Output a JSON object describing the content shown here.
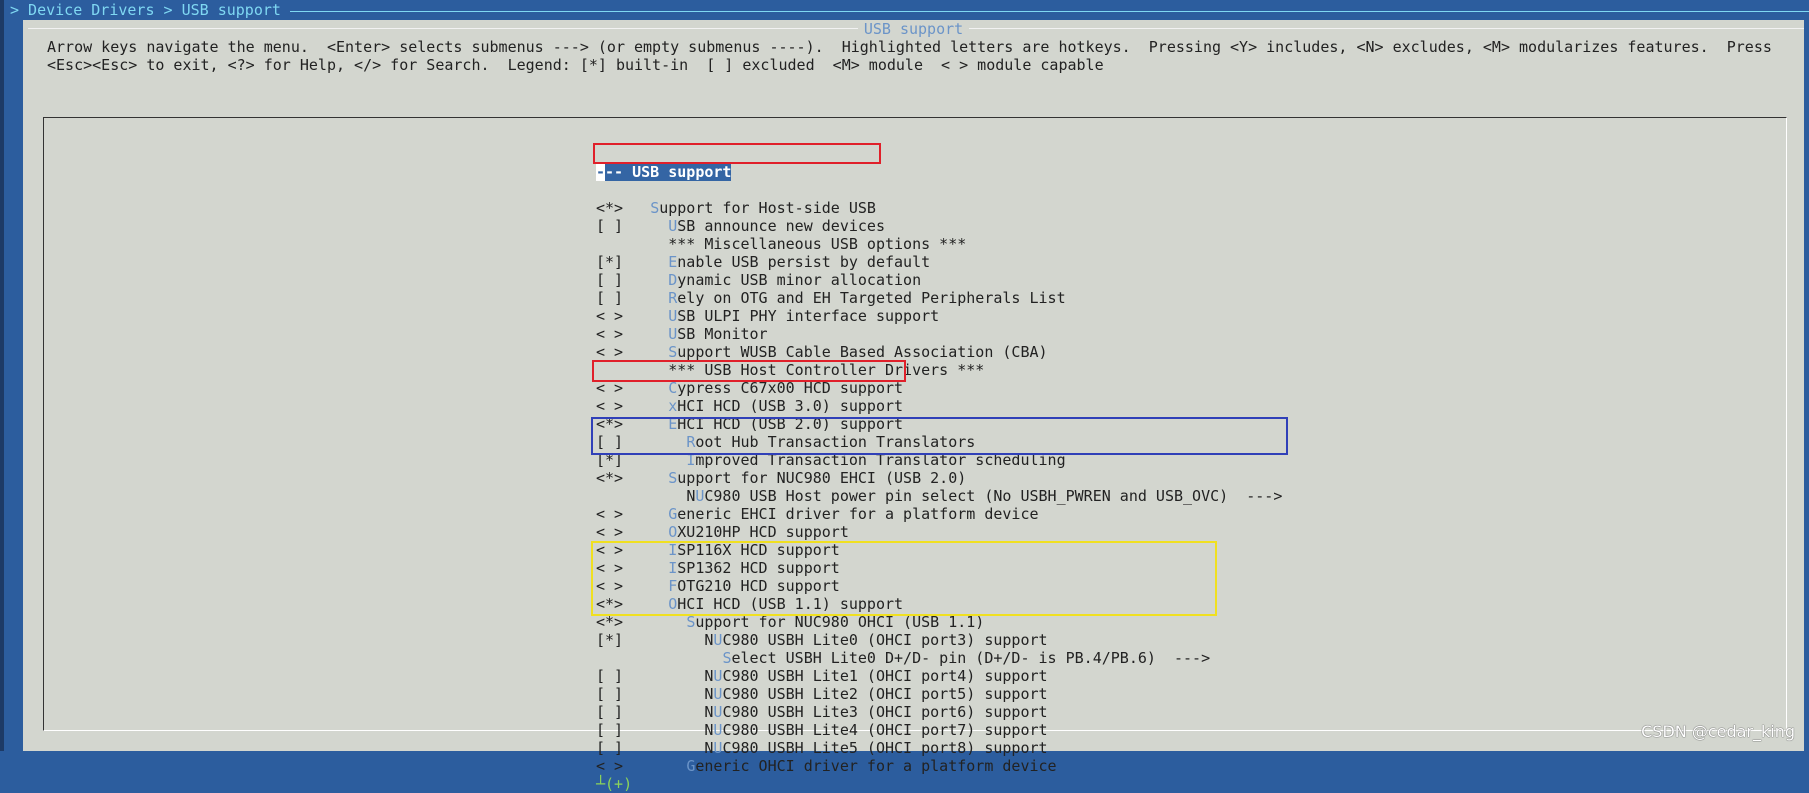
{
  "breadcrumb": "> Device Drivers > USB support",
  "dialog": {
    "title": "USB support",
    "help_line1": "Arrow keys navigate the menu.  <Enter> selects submenus ---> (or empty submenus ----).  Highlighted letters are hotkeys.  Pressing <Y> includes, <N> excludes, <M> modularizes features.  Press",
    "help_line2": "<Esc><Esc> to exit, <?> for Help, </> for Search.  Legend: [*] built-in  [ ] excluded  <M> module  < > module capable"
  },
  "menu": {
    "header": "--- USB support",
    "items": [
      {
        "state": "<*>",
        "indent": 6,
        "pre": "",
        "hot": "S",
        "post": "upport for Host-side USB"
      },
      {
        "state": "[ ]",
        "indent": 8,
        "pre": "",
        "hot": "U",
        "post": "SB announce new devices"
      },
      {
        "state": "",
        "indent": 8,
        "pre": "*** Miscellaneous USB options ***",
        "hot": "",
        "post": ""
      },
      {
        "state": "[*]",
        "indent": 8,
        "pre": "",
        "hot": "E",
        "post": "nable USB persist by default"
      },
      {
        "state": "[ ]",
        "indent": 8,
        "pre": "",
        "hot": "D",
        "post": "ynamic USB minor allocation"
      },
      {
        "state": "[ ]",
        "indent": 8,
        "pre": "",
        "hot": "R",
        "post": "ely on OTG and EH Targeted Peripherals List"
      },
      {
        "state": "< >",
        "indent": 8,
        "pre": "",
        "hot": "U",
        "post": "SB ULPI PHY interface support"
      },
      {
        "state": "< >",
        "indent": 8,
        "pre": "",
        "hot": "U",
        "post": "SB Monitor"
      },
      {
        "state": "< >",
        "indent": 8,
        "pre": "",
        "hot": "S",
        "post": "upport WUSB Cable Based Association (CBA)"
      },
      {
        "state": "",
        "indent": 8,
        "pre": "*** USB Host Controller Drivers ***",
        "hot": "",
        "post": ""
      },
      {
        "state": "< >",
        "indent": 8,
        "pre": "",
        "hot": "C",
        "post": "ypress C67x00 HCD support"
      },
      {
        "state": "< >",
        "indent": 8,
        "pre": "",
        "hot": "x",
        "post": "HCI HCD (USB 3.0) support"
      },
      {
        "state": "<*>",
        "indent": 8,
        "pre": "",
        "hot": "E",
        "post": "HCI HCD (USB 2.0) support"
      },
      {
        "state": "[ ]",
        "indent": 10,
        "pre": "",
        "hot": "R",
        "post": "oot Hub Transaction Translators"
      },
      {
        "state": "[*]",
        "indent": 10,
        "pre": "",
        "hot": "I",
        "post": "mproved Transaction Translator scheduling"
      },
      {
        "state": "<*>",
        "indent": 8,
        "pre": "",
        "hot": "S",
        "post": "upport for NUC980 EHCI (USB 2.0)"
      },
      {
        "state": "",
        "indent": 10,
        "pre": "N",
        "hot": "U",
        "post": "C980 USB Host power pin select (No USBH_PWREN and USB_OVC)  --->"
      },
      {
        "state": "< >",
        "indent": 8,
        "pre": "",
        "hot": "G",
        "post": "eneric EHCI driver for a platform device"
      },
      {
        "state": "< >",
        "indent": 8,
        "pre": "",
        "hot": "O",
        "post": "XU210HP HCD support"
      },
      {
        "state": "< >",
        "indent": 8,
        "pre": "",
        "hot": "I",
        "post": "SP116X HCD support"
      },
      {
        "state": "< >",
        "indent": 8,
        "pre": "",
        "hot": "I",
        "post": "SP1362 HCD support"
      },
      {
        "state": "< >",
        "indent": 8,
        "pre": "",
        "hot": "F",
        "post": "OTG210 HCD support"
      },
      {
        "state": "<*>",
        "indent": 8,
        "pre": "",
        "hot": "O",
        "post": "HCI HCD (USB 1.1) support"
      },
      {
        "state": "<*>",
        "indent": 10,
        "pre": "",
        "hot": "S",
        "post": "upport for NUC980 OHCI (USB 1.1)"
      },
      {
        "state": "[*]",
        "indent": 12,
        "pre": "N",
        "hot": "U",
        "post": "C980 USBH Lite0 (OHCI port3) support"
      },
      {
        "state": "",
        "indent": 14,
        "pre": "",
        "hot": "S",
        "post": "elect USBH Lite0 D+/D- pin (D+/D- is PB.4/PB.6)  --->"
      },
      {
        "state": "[ ]",
        "indent": 12,
        "pre": "N",
        "hot": "U",
        "post": "C980 USBH Lite1 (OHCI port4) support"
      },
      {
        "state": "[ ]",
        "indent": 12,
        "pre": "N",
        "hot": "U",
        "post": "C980 USBH Lite2 (OHCI port5) support"
      },
      {
        "state": "[ ]",
        "indent": 12,
        "pre": "N",
        "hot": "U",
        "post": "C980 USBH Lite3 (OHCI port6) support"
      },
      {
        "state": "[ ]",
        "indent": 12,
        "pre": "N",
        "hot": "U",
        "post": "C980 USBH Lite4 (OHCI port7) support"
      },
      {
        "state": "[ ]",
        "indent": 12,
        "pre": "N",
        "hot": "U",
        "post": "C980 USBH Lite5 (OHCI port8) support"
      },
      {
        "state": "< >",
        "indent": 10,
        "pre": "",
        "hot": "G",
        "post": "eneric OHCI driver for a platform device"
      }
    ],
    "more_indicator": "┴(+)"
  },
  "annotations": {
    "red": "#e0202a",
    "blue": "#3040b8",
    "yellow": "#f0e020"
  },
  "colors": {
    "hotkey": "#6b94c8",
    "titlebar": "#2c5d9e",
    "dialog_bg": "#d3d6cf",
    "selection": "#3465a4"
  },
  "watermark": "CSDN @cedar_king"
}
